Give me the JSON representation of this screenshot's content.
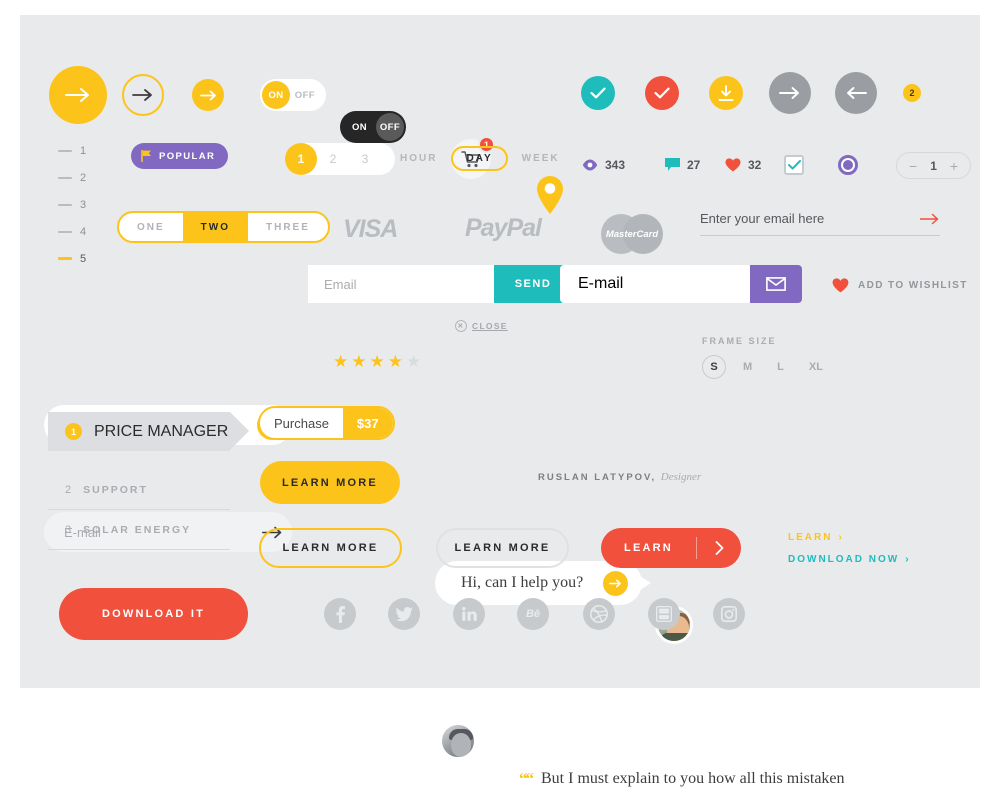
{
  "colors": {
    "yellow": "#fcc41b",
    "red": "#f0503c",
    "teal": "#1fbcbc",
    "purple": "#8169c2",
    "grey": "#9a9da1",
    "dark": "#262626",
    "canvas": "#e9eaec"
  },
  "row_arrows": {
    "big_arrow_label": "arrow-right",
    "ring_arrow_label": "arrow-right",
    "small_arrow_label": "arrow-right"
  },
  "toggles": {
    "light": {
      "on": "ON",
      "off": "OFF",
      "state": "on"
    },
    "dark": {
      "on": "ON",
      "off": "OFF",
      "state": "off"
    }
  },
  "cart": {
    "badge": "1"
  },
  "icons_row": {
    "pin": "location-pin-icon",
    "check_teal": "check-icon",
    "check_red": "check-icon",
    "download": "download-icon",
    "next": "arrow-right-icon",
    "prev": "arrow-left-icon",
    "badge_count": "2"
  },
  "steps": [
    {
      "num": "1",
      "active": false
    },
    {
      "num": "2",
      "active": false
    },
    {
      "num": "3",
      "active": false
    },
    {
      "num": "4",
      "active": false
    },
    {
      "num": "5",
      "active": true
    }
  ],
  "popular_badge": {
    "label": "POPULAR",
    "icon": "flag-icon"
  },
  "pagination": {
    "pages": [
      "1",
      "2",
      "3"
    ],
    "active": "1"
  },
  "period_tabs": {
    "items": [
      "HOUR",
      "DAY",
      "WEEK"
    ],
    "active": "DAY"
  },
  "stats": [
    {
      "icon": "eye-icon",
      "value": "343",
      "color": "#8169c2"
    },
    {
      "icon": "comment-icon",
      "value": "27",
      "color": "#1fbcbc"
    },
    {
      "icon": "heart-icon",
      "value": "32",
      "color": "#f0503c"
    }
  ],
  "checkbox": {
    "checked": true,
    "icon": "check-icon"
  },
  "radio": {
    "selected": true
  },
  "stepper": {
    "minus": "−",
    "value": "1",
    "plus": "+"
  },
  "segmented": {
    "items": [
      "ONE",
      "TWO",
      "THREE"
    ],
    "active": "TWO"
  },
  "payments": [
    {
      "name": "VISA"
    },
    {
      "name": "PayPal"
    },
    {
      "name": "MasterCard"
    }
  ],
  "newsletter_underline": {
    "placeholder": "Enter your email here",
    "submit_icon": "arrow-right-icon"
  },
  "inputs": {
    "pill_yellow": {
      "placeholder": "E-mail",
      "action_icon": "paper-plane-icon"
    },
    "square_teal": {
      "placeholder": "Email",
      "button_label": "SEND"
    },
    "square_purple": {
      "placeholder": "E-mail",
      "action_icon": "envelope-icon"
    },
    "pill_grey": {
      "placeholder": "E-mail",
      "action_icon": "arrow-right-icon"
    }
  },
  "wishlist": {
    "label": "ADD TO WISHLIST",
    "icon": "heart-icon"
  },
  "rating": {
    "filled": 4,
    "total": 5
  },
  "chat": {
    "close_label": "CLOSE",
    "message": "Hi, can I help you?",
    "send_icon": "arrow-right-icon"
  },
  "frame_size": {
    "title": "FRAME SIZE",
    "options": [
      "S",
      "M",
      "L",
      "XL"
    ],
    "active": "S"
  },
  "price_manager": [
    {
      "num": "1",
      "label": "PRICE MANAGER",
      "active": true
    },
    {
      "num": "2",
      "label": "SUPPORT",
      "active": false
    },
    {
      "num": "3",
      "label": "SOLAR ENERGY",
      "active": false
    }
  ],
  "purchase": {
    "label": "Purchase",
    "price": "$37"
  },
  "buttons": {
    "learn_more_solid": "LEARN MORE",
    "learn_more_outline": "LEARN MORE",
    "learn_more_grey": "LEARN MORE",
    "learn_red": "LEARN",
    "download_it": "DOWNLOAD IT"
  },
  "text_links": [
    {
      "label": "LEARN",
      "chevron": "›",
      "color": "yellow"
    },
    {
      "label": "DOWNLOAD NOW",
      "chevron": "›",
      "color": "teal"
    }
  ],
  "testimonial": {
    "quote_mark": "““",
    "text": "But I must explain to you how all this mistaken",
    "author": "RUSLAN LATYPOV,",
    "role": "Designer"
  },
  "social": [
    {
      "name": "facebook",
      "glyph": "f"
    },
    {
      "name": "twitter",
      "glyph": "t"
    },
    {
      "name": "linkedin",
      "glyph": "in"
    },
    {
      "name": "behance",
      "glyph": "Bē"
    },
    {
      "name": "dribbble",
      "glyph": "d"
    },
    {
      "name": "youtube",
      "glyph": "yt"
    },
    {
      "name": "instagram",
      "glyph": "ig"
    }
  ]
}
